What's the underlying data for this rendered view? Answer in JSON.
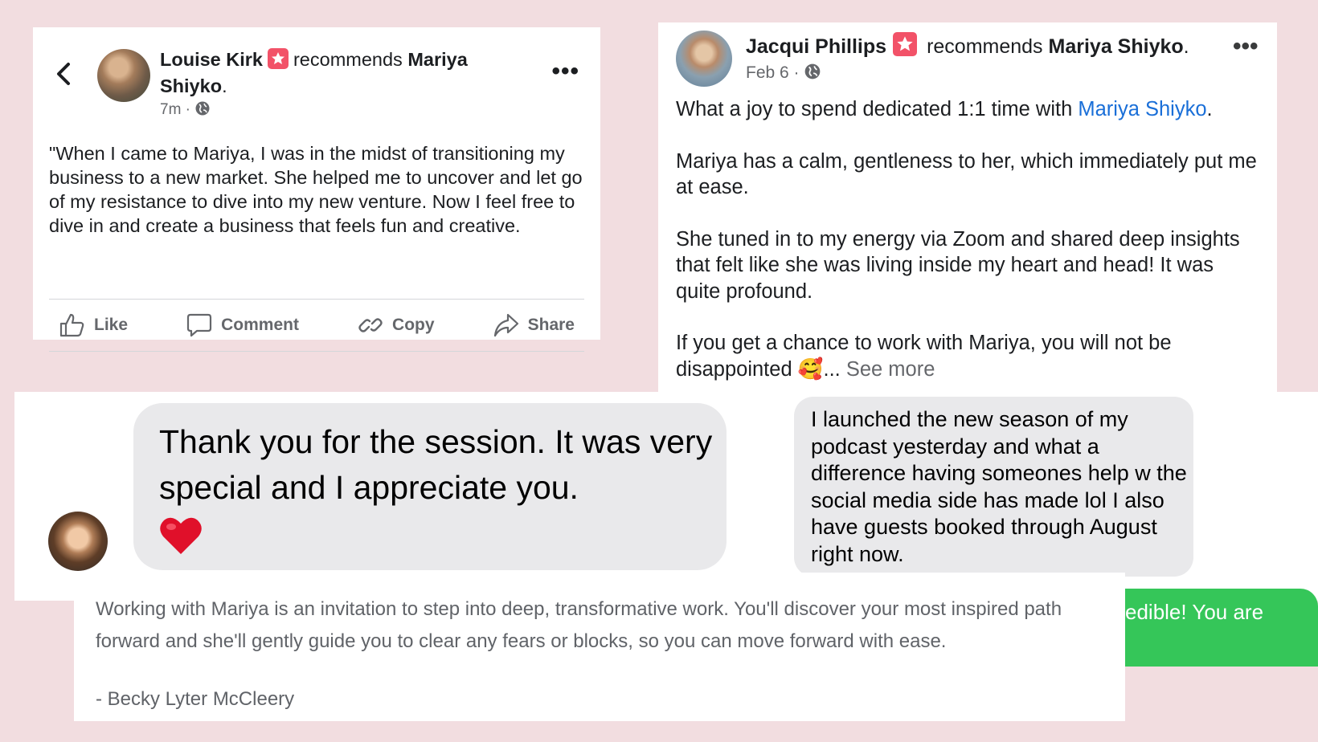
{
  "louise_post": {
    "author": "Louise Kirk",
    "action": "recommends",
    "target": "Mariya Shiyko",
    "time": "7m",
    "body": "\"When I came to Mariya, I was in the midst of transitioning my business to a new market. She helped me to uncover and let go of my resistance to dive into my new venture. Now I feel free to dive in and create a business that feels fun and creative.",
    "actions": [
      {
        "label": "Like",
        "icon": "thumbs-up-icon"
      },
      {
        "label": "Comment",
        "icon": "comment-icon"
      },
      {
        "label": "Copy",
        "icon": "link-icon"
      },
      {
        "label": "Share",
        "icon": "share-icon"
      }
    ]
  },
  "jacqui_post": {
    "author": "Jacqui Phillips",
    "action": "recommends",
    "target": "Mariya Shiyko",
    "time": "Feb 6",
    "line1_prefix": "What a joy to spend dedicated 1:1 time with ",
    "line1_link": "Mariya Shiyko",
    "p2": "Mariya has a calm, gentleness to her, which immediately put me at ease.",
    "p3": "She tuned in to my energy via Zoom and shared deep insights that felt like she was living inside my heart and head! It was quite profound.",
    "p4": "If you get a chance to work with Mariya, you will not be disappointed",
    "emoji": "🥰",
    "ellipsis": "...",
    "see_more": "See more"
  },
  "messages": {
    "bubble1": "Thank you for the session. It was very special and I appreciate you.",
    "bubble2": "I launched the new season of my podcast yesterday and what a difference having someones help w the social media side has made lol I also have guests booked through August right now.",
    "green_partial": "edible! You are"
  },
  "becky_quote": {
    "text": "Working with Mariya is an invitation to step into deep, transformative work. You'll discover your most inspired path forward and she'll gently guide you to clear any fears or blocks, so you can move forward with ease.",
    "signature": "- Becky Lyter McCleery"
  },
  "colors": {
    "background": "#f2dde0",
    "badge": "#f25268",
    "link": "#1a6fd8",
    "imessage_green": "#35c659",
    "bubble_gray": "#e9e9eb"
  }
}
